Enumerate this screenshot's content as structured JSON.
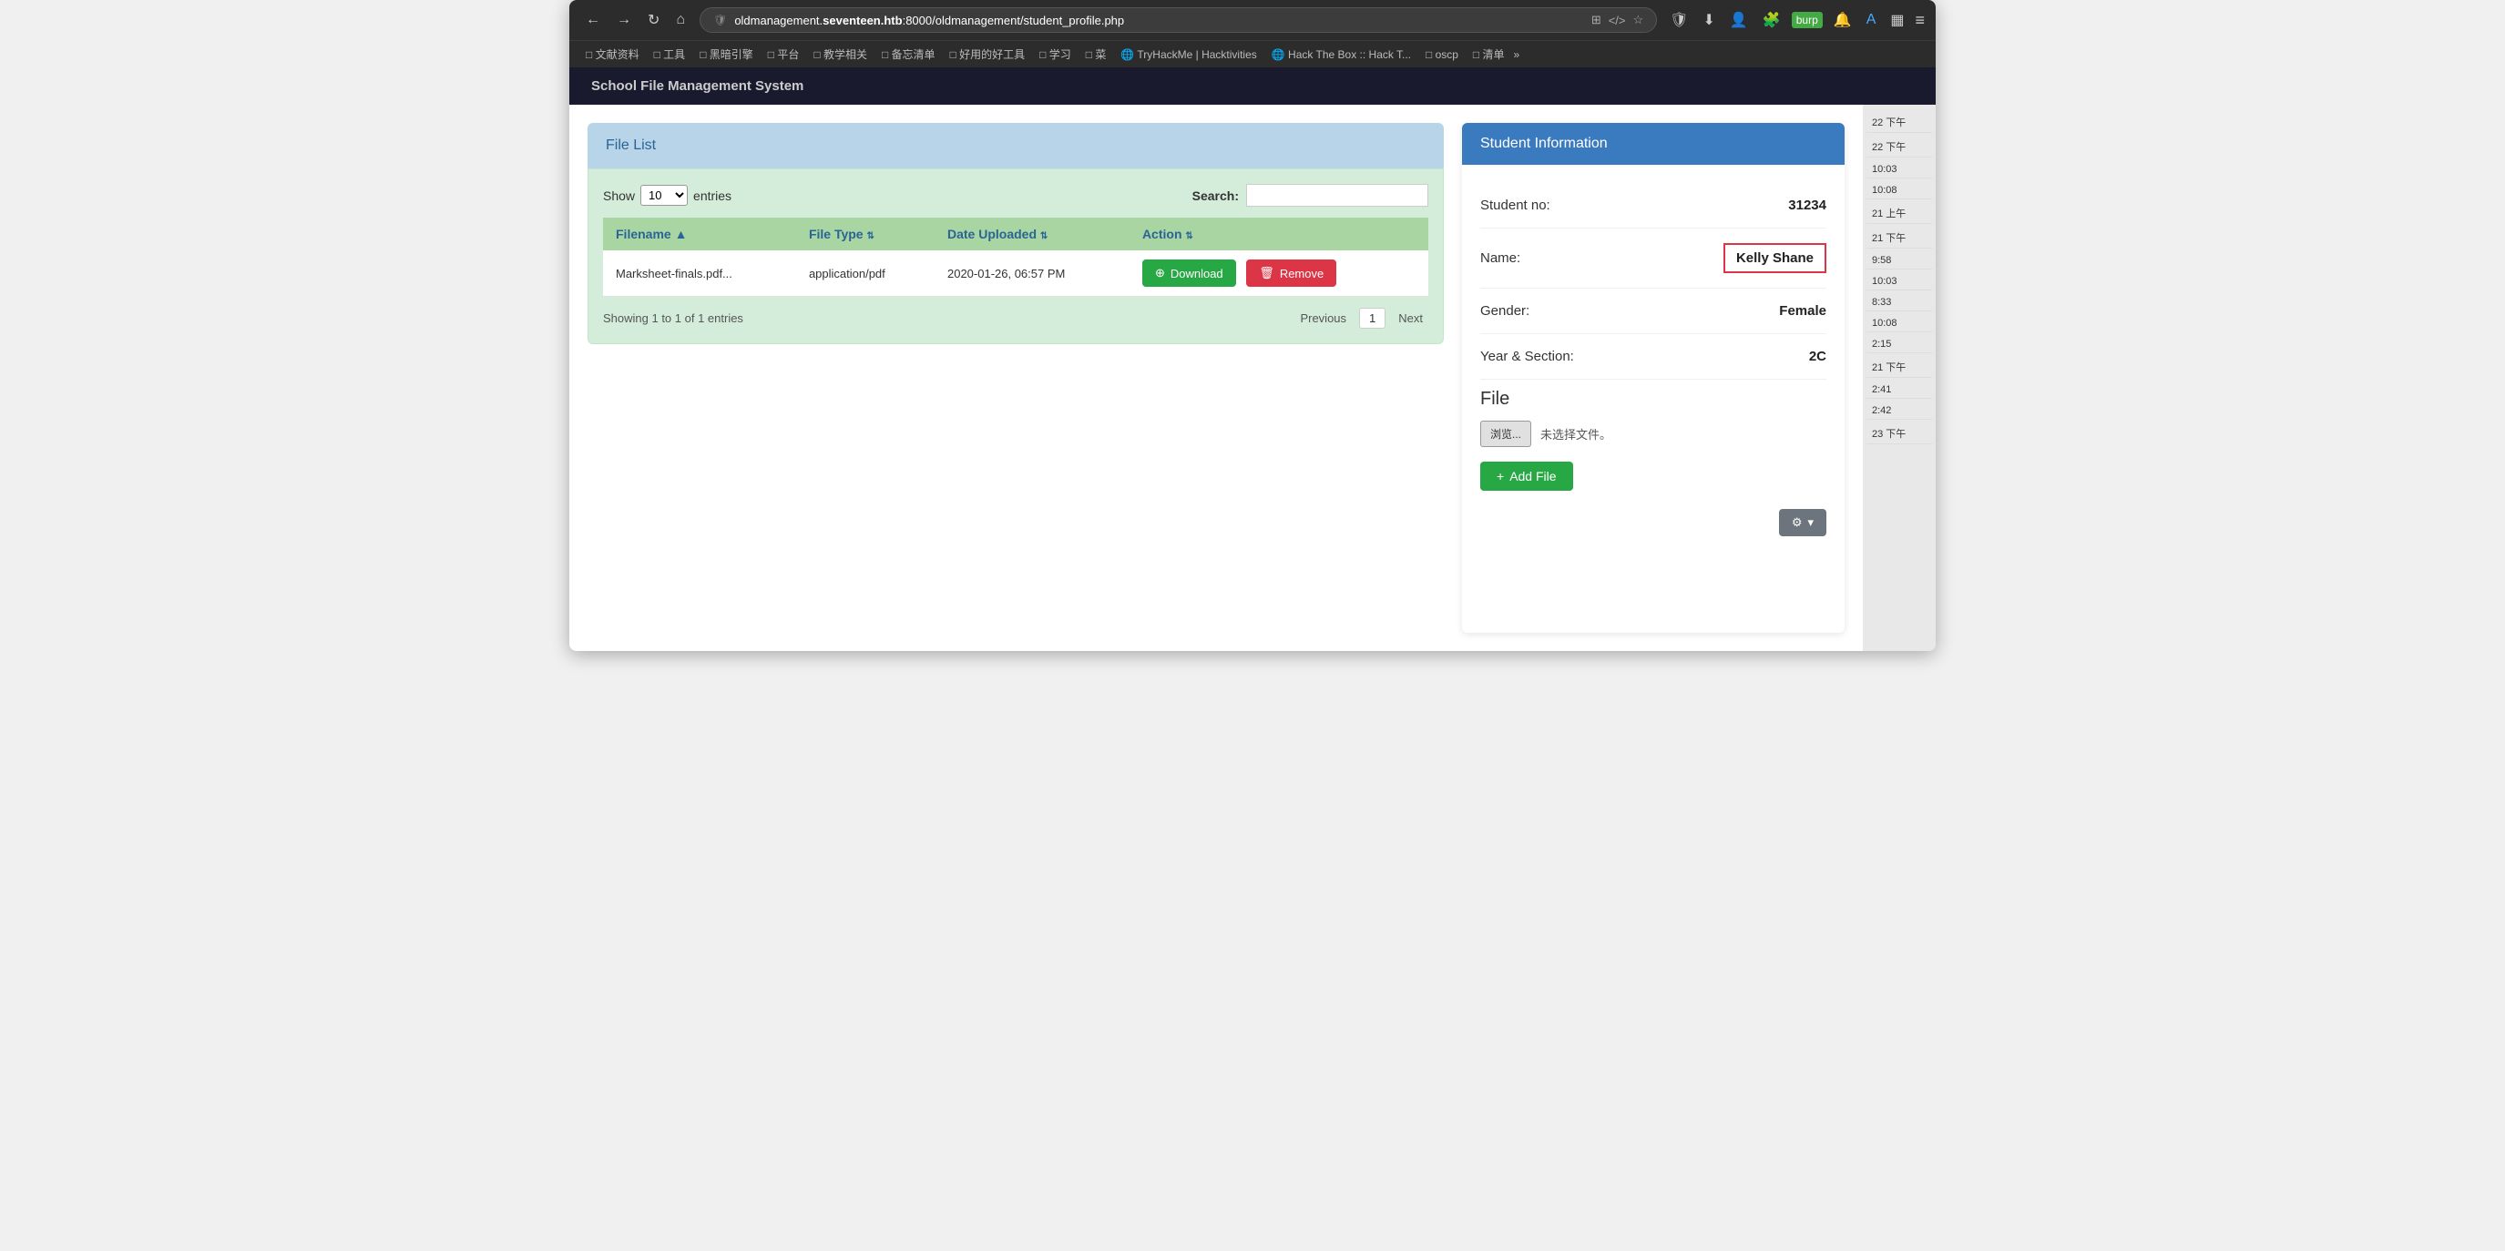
{
  "browser": {
    "url_prefix": "oldmanagement.",
    "url_domain": "seventeen.htb",
    "url_path": ":8000/oldmanagement/student_profile.php"
  },
  "bookmarks": [
    {
      "label": "□ 文献资料"
    },
    {
      "label": "□ 工具"
    },
    {
      "label": "□ 黑暗引擎"
    },
    {
      "label": "□ 平台"
    },
    {
      "label": "□ 教学相关"
    },
    {
      "label": "□ 备忘清单"
    },
    {
      "label": "□ 好用的好工具"
    },
    {
      "label": "□ 学习"
    },
    {
      "label": "□ 菜"
    },
    {
      "label": "🌐 TryHackMe | Hacktivities"
    },
    {
      "label": "🌐 Hack The Box :: Hack T..."
    },
    {
      "label": "□ oscp"
    },
    {
      "label": "□ 清单"
    }
  ],
  "app": {
    "title": "School File Management System"
  },
  "file_list": {
    "header": "File List",
    "show_label": "Show",
    "entries_label": "entries",
    "entries_value": "10",
    "search_label": "Search:",
    "search_placeholder": "",
    "table": {
      "columns": [
        {
          "label": "Filename",
          "sortable": true
        },
        {
          "label": "File Type",
          "sortable": true
        },
        {
          "label": "Date Uploaded",
          "sortable": true
        },
        {
          "label": "Action",
          "sortable": true
        }
      ],
      "rows": [
        {
          "filename": "Marksheet-finals.pdf...",
          "filetype": "application/pdf",
          "date_uploaded": "2020-01-26, 06:57 PM"
        }
      ]
    },
    "showing_text": "Showing 1 to 1 of 1 entries",
    "previous_btn": "Previous",
    "page_num": "1",
    "next_btn": "Next",
    "download_btn": "Download",
    "remove_btn": "Remove"
  },
  "student_info": {
    "header": "Student Information",
    "student_no_label": "Student no:",
    "student_no_value": "31234",
    "name_label": "Name:",
    "name_value": "Kelly Shane",
    "gender_label": "Gender:",
    "gender_value": "Female",
    "year_section_label": "Year & Section:",
    "year_section_value": "2C",
    "file_section_title": "File",
    "browse_btn": "浏览...",
    "no_file_text": "未选择文件。",
    "add_file_btn": "+ Add File",
    "settings_btn": "⚙ ▾"
  },
  "right_times": [
    "22 下午",
    "22 下午",
    "10:03",
    "10:08",
    "21 上午",
    "21 下午",
    "9:58",
    "10:03",
    "8:33",
    "10:08",
    "2:15",
    "21 下午",
    "2:41",
    "2:42",
    "23 下午"
  ],
  "icons": {
    "back": "←",
    "forward": "→",
    "refresh": "↻",
    "home": "⌂",
    "shield": "🛡",
    "bookmark": "☆",
    "translate": "⊞",
    "code": "</>",
    "star": "★",
    "more": "≡",
    "download_icon": "⊕",
    "trash_icon": "🗑",
    "plus_icon": "+"
  }
}
